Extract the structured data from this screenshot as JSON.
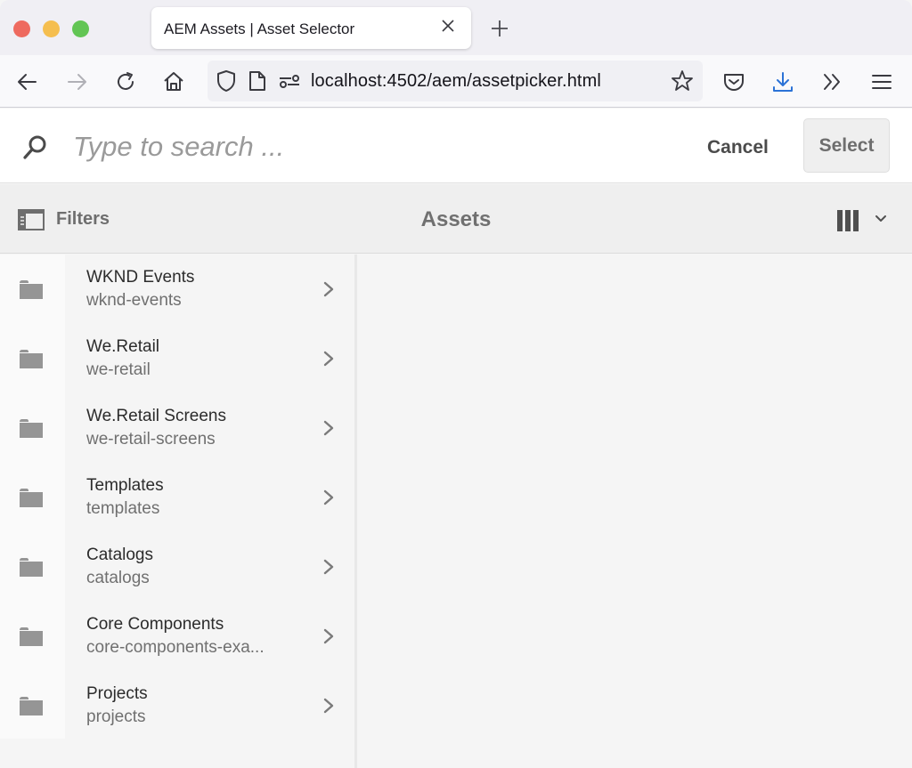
{
  "browser": {
    "tab_title": "AEM Assets | Asset Selector",
    "url": "localhost:4502/aem/assetpicker.html",
    "icons": {
      "back": "arrow-left-icon",
      "forward": "arrow-right-icon",
      "reload": "reload-icon",
      "home": "home-icon",
      "tracking": "shield-icon",
      "page": "page-icon",
      "permissions": "permissions-icon",
      "bookmark": "star-icon",
      "pocket": "pocket-icon",
      "downloads": "download-icon",
      "overflow": "chevrons-right-icon",
      "menu": "hamburger-menu-icon"
    },
    "accent_color": "#2b72d6"
  },
  "search": {
    "placeholder": "Type to search ...",
    "value": "",
    "cancel_label": "Cancel",
    "select_label": "Select"
  },
  "toolbar": {
    "filters_label": "Filters",
    "title": "Assets",
    "view_mode": "column-view-icon"
  },
  "columns": [
    {
      "items": [
        {
          "title": "WKND Events",
          "name": "wknd-events"
        },
        {
          "title": "We.Retail",
          "name": "we-retail"
        },
        {
          "title": "We.Retail Screens",
          "name": "we-retail-screens"
        },
        {
          "title": "Templates",
          "name": "templates"
        },
        {
          "title": "Catalogs",
          "name": "catalogs"
        },
        {
          "title": "Core Components",
          "name": "core-components-exa..."
        },
        {
          "title": "Projects",
          "name": "projects"
        }
      ]
    }
  ]
}
